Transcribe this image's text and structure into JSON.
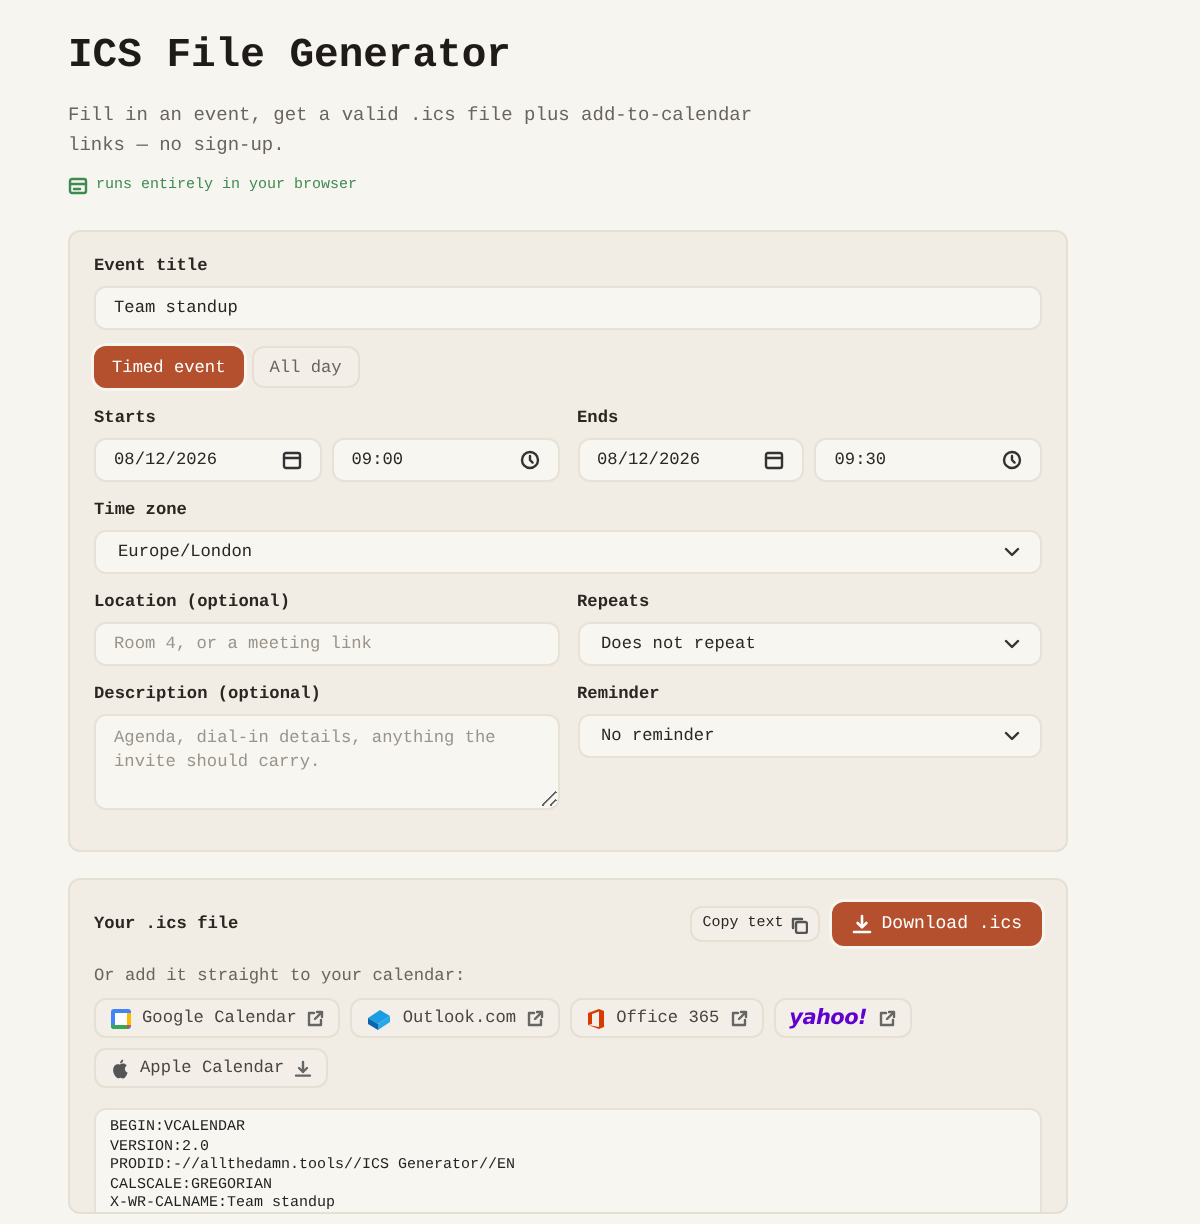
{
  "header": {
    "title": "ICS File Generator",
    "subtitle": "Fill in an event, get a valid .ics file plus add-to-calendar links — no sign-up.",
    "badge": "runs entirely in your browser"
  },
  "event_form": {
    "title_field": {
      "label": "Event title",
      "value": "Team standup"
    },
    "modes": [
      {
        "label": "Timed event",
        "selected": true
      },
      {
        "label": "All day",
        "selected": false
      }
    ],
    "starts": {
      "label": "Starts",
      "date": "08/12/2026",
      "time": "09:00"
    },
    "ends": {
      "label": "Ends",
      "date": "08/12/2026",
      "time": "09:30"
    },
    "time_zone": {
      "label": "Time zone",
      "value": "Europe/London"
    },
    "location": {
      "label": "Location (optional)",
      "placeholder": "Room 4, or a meeting link"
    },
    "repeats": {
      "label": "Repeats",
      "value": "Does not repeat"
    },
    "description": {
      "label": "Description (optional)",
      "placeholder": "Agenda, dial-in details, anything the invite should carry."
    },
    "reminder": {
      "label": "Reminder",
      "value": "No reminder"
    }
  },
  "output": {
    "title": "Your .ics file",
    "copy_button": "Copy text",
    "download_button": "Download .ics",
    "links_label": "Or add it straight to your calendar:",
    "calendar_links": [
      {
        "kind": "google",
        "label": "Google Calendar",
        "downloads": false
      },
      {
        "kind": "outlook",
        "label": "Outlook.com",
        "downloads": false
      },
      {
        "kind": "office",
        "label": "Office 365",
        "downloads": false
      },
      {
        "kind": "yahoo",
        "label": "yahoo!",
        "downloads": false
      },
      {
        "kind": "apple",
        "label": "Apple Calendar",
        "downloads": true
      }
    ],
    "ics_lines": [
      "BEGIN:VCALENDAR",
      "VERSION:2.0",
      "PRODID:-//allthedamn.tools//ICS Generator//EN",
      "CALSCALE:GREGORIAN",
      "X-WR-CALNAME:Team standup"
    ]
  }
}
